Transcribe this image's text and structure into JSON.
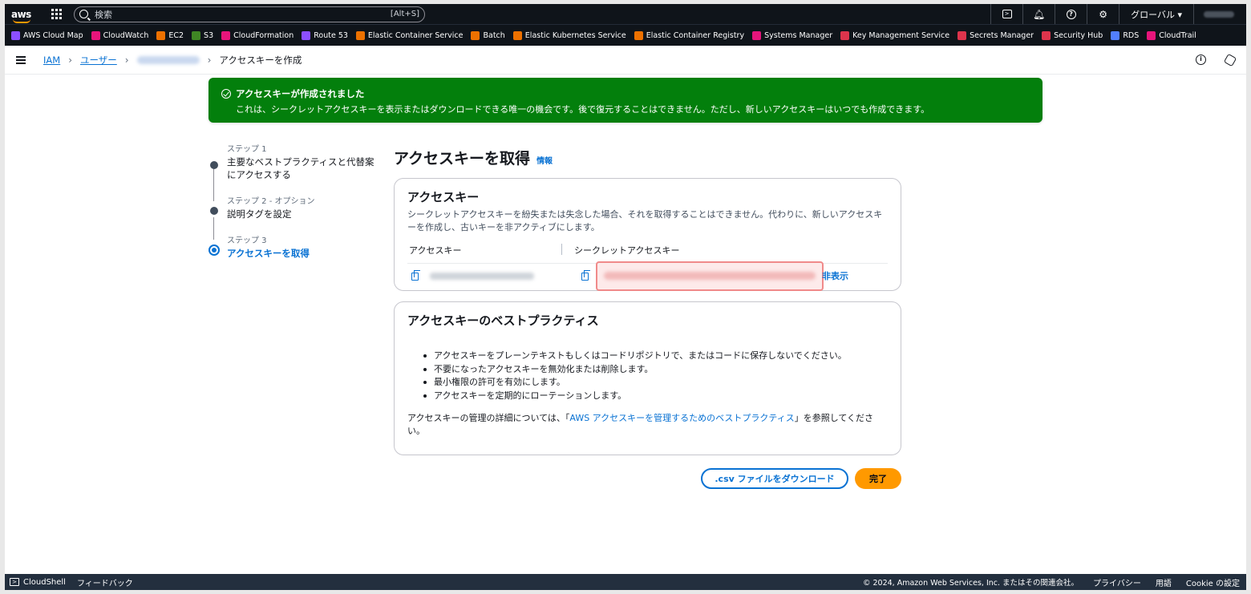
{
  "topnav": {
    "search_placeholder": "検索",
    "search_shortcut": "[Alt+S]",
    "region": "グローバル ▾"
  },
  "favorites": [
    {
      "label": "AWS Cloud Map",
      "color": "#8c4fff"
    },
    {
      "label": "CloudWatch",
      "color": "#e7157b"
    },
    {
      "label": "EC2",
      "color": "#ed7100"
    },
    {
      "label": "S3",
      "color": "#3f8624"
    },
    {
      "label": "CloudFormation",
      "color": "#e7157b"
    },
    {
      "label": "Route 53",
      "color": "#8c4fff"
    },
    {
      "label": "Elastic Container Service",
      "color": "#ed7100"
    },
    {
      "label": "Batch",
      "color": "#ed7100"
    },
    {
      "label": "Elastic Kubernetes Service",
      "color": "#ed7100"
    },
    {
      "label": "Elastic Container Registry",
      "color": "#ed7100"
    },
    {
      "label": "Systems Manager",
      "color": "#e7157b"
    },
    {
      "label": "Key Management Service",
      "color": "#dd344c"
    },
    {
      "label": "Secrets Manager",
      "color": "#dd344c"
    },
    {
      "label": "Security Hub",
      "color": "#dd344c"
    },
    {
      "label": "RDS",
      "color": "#527fff"
    },
    {
      "label": "CloudTrail",
      "color": "#e7157b"
    }
  ],
  "breadcrumb": {
    "iam": "IAM",
    "users": "ユーザー",
    "current": "アクセスキーを作成"
  },
  "flash": {
    "title": "アクセスキーが作成されました",
    "message": "これは、シークレットアクセスキーを表示またはダウンロードできる唯一の機会です。後で復元することはできません。ただし、新しいアクセスキーはいつでも作成できます。"
  },
  "steps": [
    {
      "label": "ステップ 1",
      "title": "主要なベストプラクティスと代替案にアクセスする"
    },
    {
      "label": "ステップ 2 - オプション",
      "title": "説明タグを設定"
    },
    {
      "label": "ステップ 3",
      "title": "アクセスキーを取得"
    }
  ],
  "main": {
    "title": "アクセスキーを取得",
    "info": "情報"
  },
  "access_key_card": {
    "title": "アクセスキー",
    "description": "シークレットアクセスキーを紛失または失念した場合、それを取得することはできません。代わりに、新しいアクセスキーを作成し、古いキーを非アクティブにします。",
    "col_access_key": "アクセスキー",
    "col_secret": "シークレットアクセスキー",
    "hide": "非表示"
  },
  "best_practices": {
    "title": "アクセスキーのベストプラクティス",
    "items": [
      "アクセスキーをプレーンテキストもしくはコードリポジトリで、またはコードに保存しないでください。",
      "不要になったアクセスキーを無効化または削除します。",
      "最小権限の許可を有効にします。",
      "アクセスキーを定期的にローテーションします。"
    ],
    "ref_prefix": "アクセスキーの管理の詳細については、「",
    "ref_link": "AWS アクセスキーを管理するためのベストプラクティス",
    "ref_suffix": "」を参照してください。"
  },
  "actions": {
    "download": ".csv ファイルをダウンロード",
    "done": "完了"
  },
  "footer": {
    "cloudshell": "CloudShell",
    "feedback": "フィードバック",
    "copyright": "© 2024, Amazon Web Services, Inc. またはその関連会社。",
    "privacy": "プライバシー",
    "terms": "用語",
    "cookie": "Cookie の設定"
  }
}
